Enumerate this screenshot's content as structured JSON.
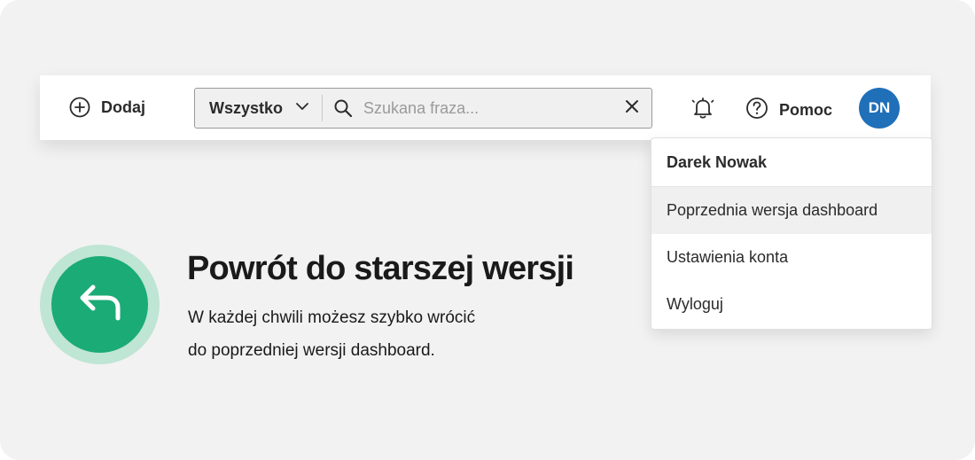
{
  "toolbar": {
    "add_label": "Dodaj",
    "search": {
      "scope_label": "Wszystko",
      "placeholder": "Szukana fraza...",
      "value": ""
    },
    "help_label": "Pomoc",
    "avatar_initials": "DN"
  },
  "user_menu": {
    "user_name": "Darek Nowak",
    "items": [
      {
        "label": "Poprzednia wersja dashboard",
        "highlighted": true
      },
      {
        "label": "Ustawienia konta",
        "highlighted": false
      },
      {
        "label": "Wyloguj",
        "highlighted": false
      }
    ]
  },
  "hero": {
    "title": "Powrót do starszej wersji",
    "text_line1": "W każdej chwili możesz szybko wrócić",
    "text_line2": "do poprzedniej wersji dashboard.",
    "icon": "return-arrow-icon"
  },
  "colors": {
    "avatar": "#1f6fb9",
    "hero_icon_bg": "#1aab77",
    "hero_icon_ring": "#bfe5d4",
    "background": "#f2f2f2"
  },
  "icons": [
    "plus-circle-icon",
    "chevron-down-icon",
    "search-icon",
    "close-icon",
    "bell-icon",
    "help-circle-icon",
    "return-arrow-icon"
  ]
}
